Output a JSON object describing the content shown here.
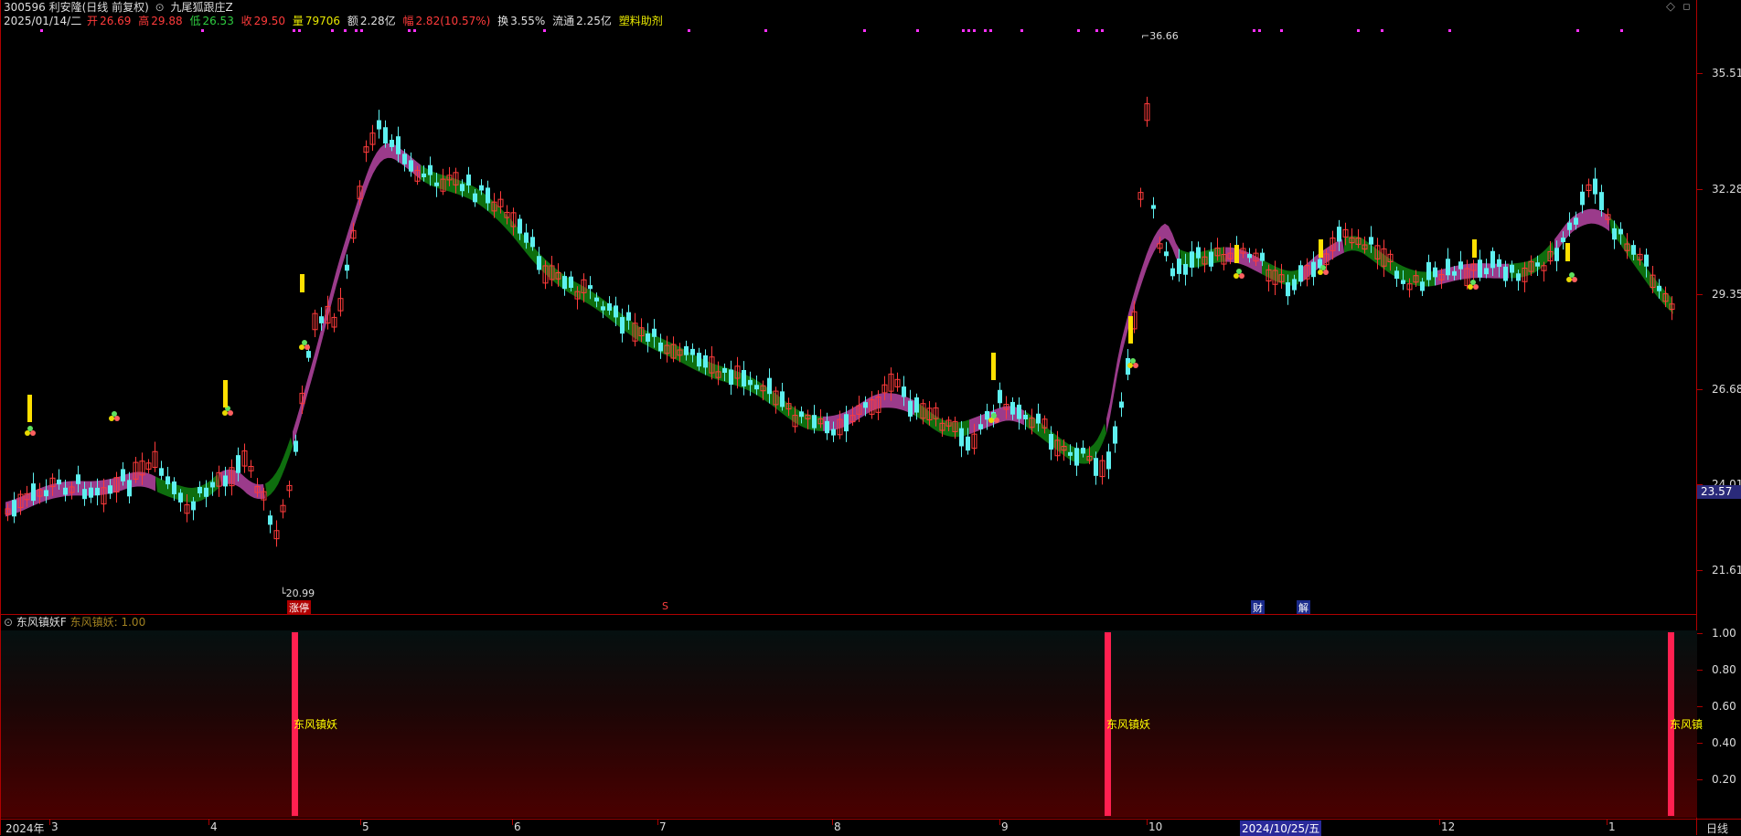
{
  "header": {
    "code_name": "300596 利安隆(日线 前复权)",
    "indicator_name": "九尾狐跟庄Z"
  },
  "infobar": {
    "date": "2025/01/14/二",
    "open_label": "开",
    "open": "26.69",
    "high_label": "高",
    "high": "29.88",
    "low_label": "低",
    "low": "26.53",
    "close_label": "收",
    "close": "29.50",
    "volume_label": "量",
    "volume": "79706",
    "amount_label": "额",
    "amount": "2.28亿",
    "change_label": "幅",
    "change": "2.82(10.57%)",
    "turnover_label": "换",
    "turnover": "3.55%",
    "float_label": "流通",
    "float": "2.25亿",
    "sector": "塑料助剂"
  },
  "main_chart": {
    "price_axis": [
      "35.51",
      "32.28",
      "29.35",
      "26.68",
      "24.01",
      "21.61"
    ],
    "current_price": "23.57",
    "high_marker": "36.66",
    "low_marker": "20.99",
    "events": {
      "limit_up": "涨停",
      "financial": "财",
      "unlock": "解",
      "small_mark": "S"
    }
  },
  "sub_chart": {
    "title": "东风镇妖F",
    "value_label": "东风镇妖: 1.00",
    "axis": [
      "1.00",
      "0.80",
      "0.60",
      "0.40",
      "0.20"
    ],
    "signal_text": "东风镇妖",
    "signal_text_cut": "东风镇"
  },
  "x_axis": {
    "labels": [
      "2024年",
      "3",
      "4",
      "5",
      "6",
      "7",
      "8",
      "9",
      "10",
      "11",
      "12",
      "1"
    ],
    "cursor_date": "2024/10/25/五",
    "period": "日线"
  },
  "colors": {
    "up": "#ff3b3b",
    "down": "#5ef0f0",
    "band_up": "#9b3b8b",
    "band_down": "#0e6e0e",
    "signal": "#ff2050",
    "axis": "#b00000"
  },
  "icons": [
    "diamond-icon",
    "window-icon"
  ]
}
